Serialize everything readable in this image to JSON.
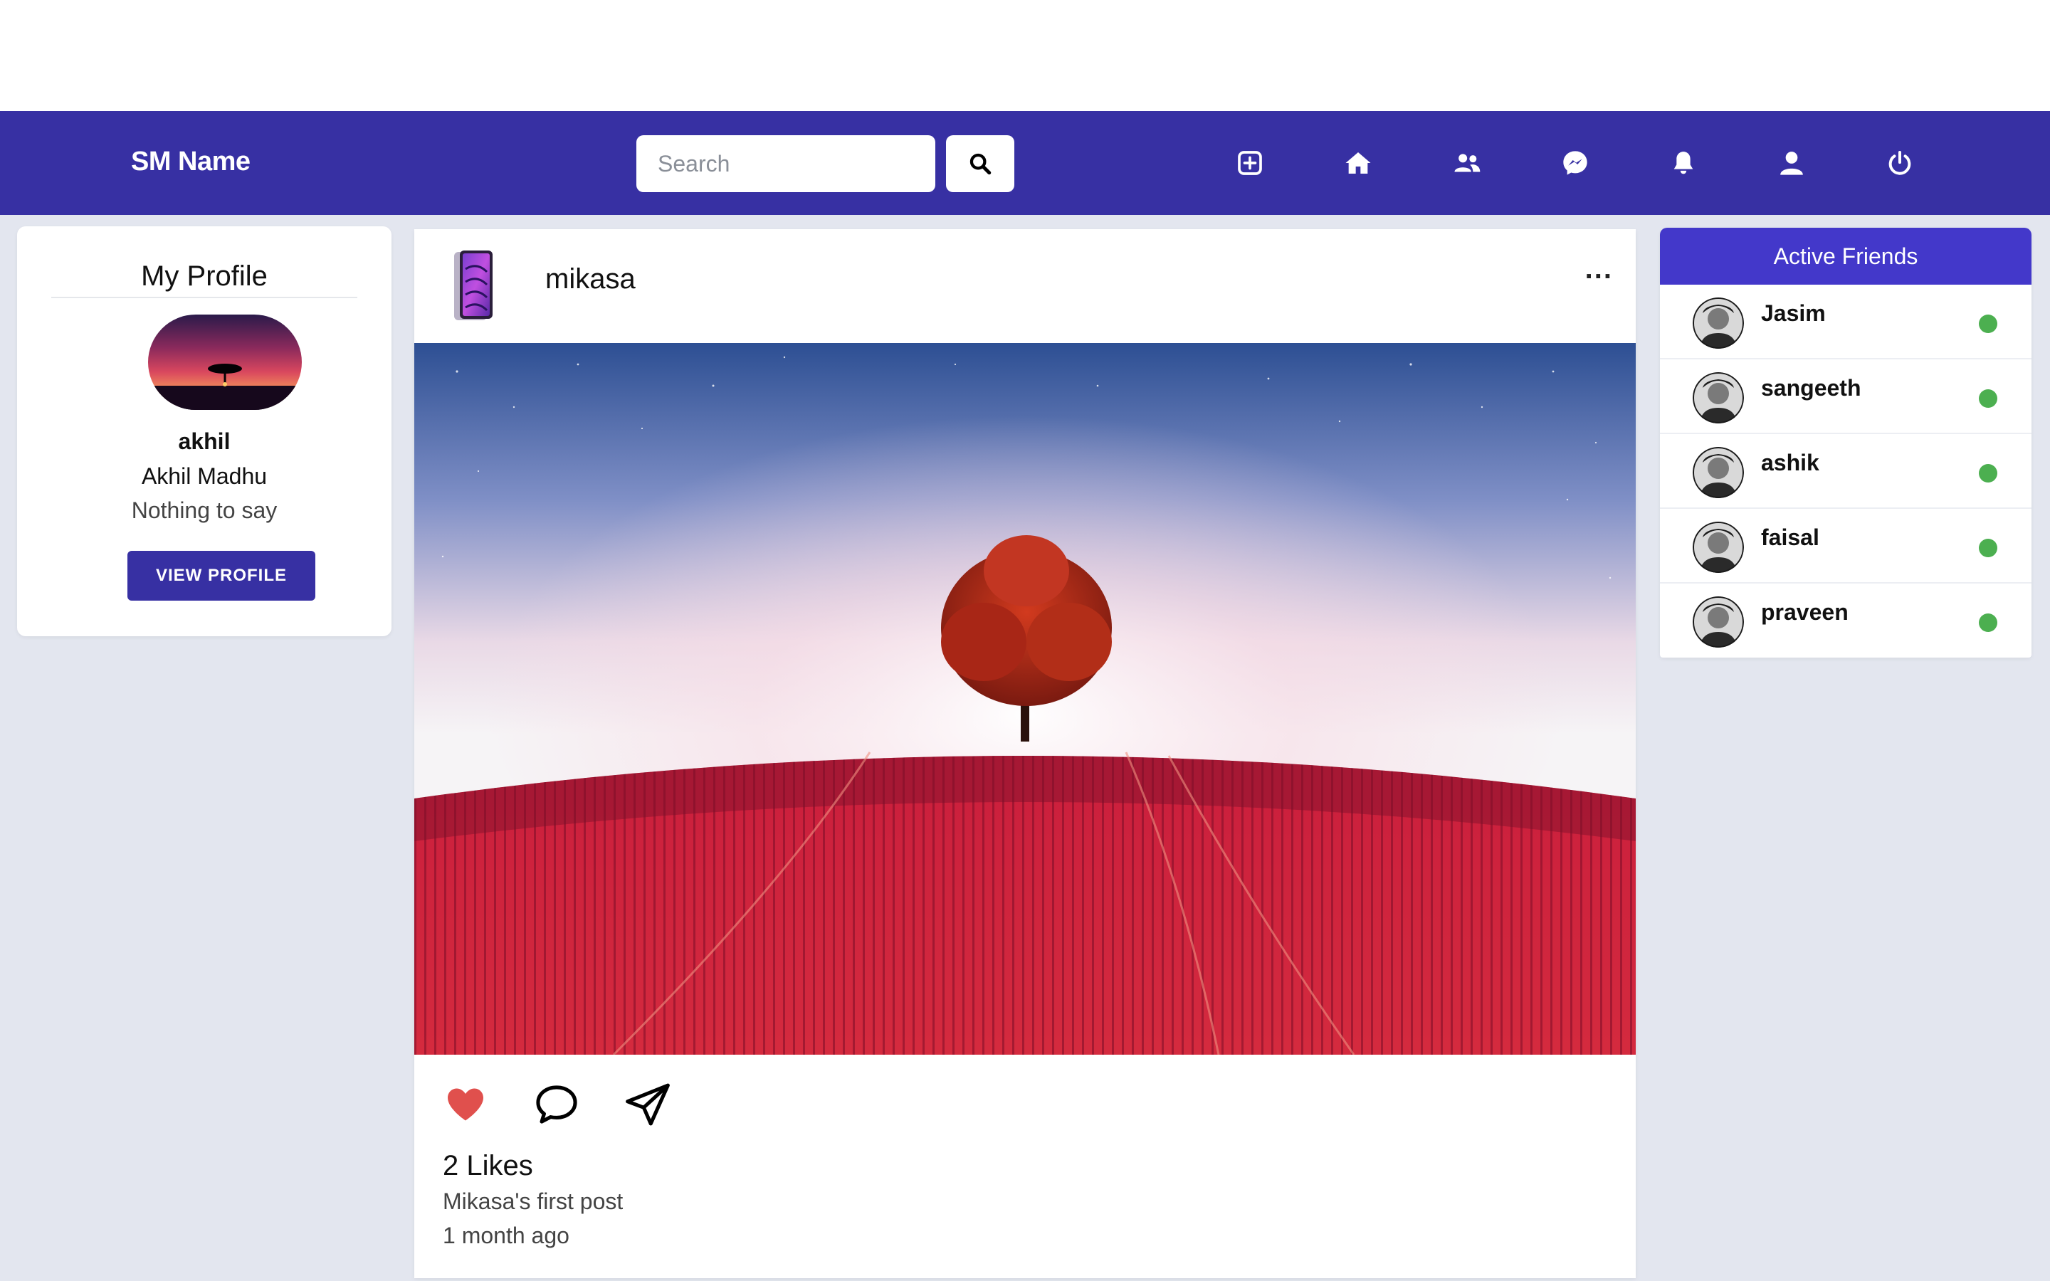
{
  "header": {
    "brand": "SM Name",
    "search_placeholder": "Search",
    "nav_icons": [
      "add-post-icon",
      "home-icon",
      "friends-icon",
      "messenger-icon",
      "notifications-icon",
      "profile-icon",
      "logout-icon"
    ]
  },
  "profile": {
    "title": "My Profile",
    "username": "akhil",
    "full_name": "Akhil Madhu",
    "bio": "Nothing to say",
    "view_button": "VIEW PROFILE"
  },
  "post": {
    "username": "mikasa",
    "menu": "...",
    "likes": "2 Likes",
    "caption": "Mikasa's first post",
    "time": "1 month ago",
    "liked": true
  },
  "friends": {
    "title": "Active Friends",
    "items": [
      {
        "name": "Jasim",
        "online": true
      },
      {
        "name": "sangeeth",
        "online": true
      },
      {
        "name": "ashik",
        "online": true
      },
      {
        "name": "faisal",
        "online": true
      },
      {
        "name": "praveen",
        "online": true
      }
    ]
  },
  "colors": {
    "nav_bg": "#3730a3",
    "accent": "#4338ca",
    "like": "#e0504d",
    "online": "#4caf50",
    "page_bg": "#e3e6ef"
  }
}
